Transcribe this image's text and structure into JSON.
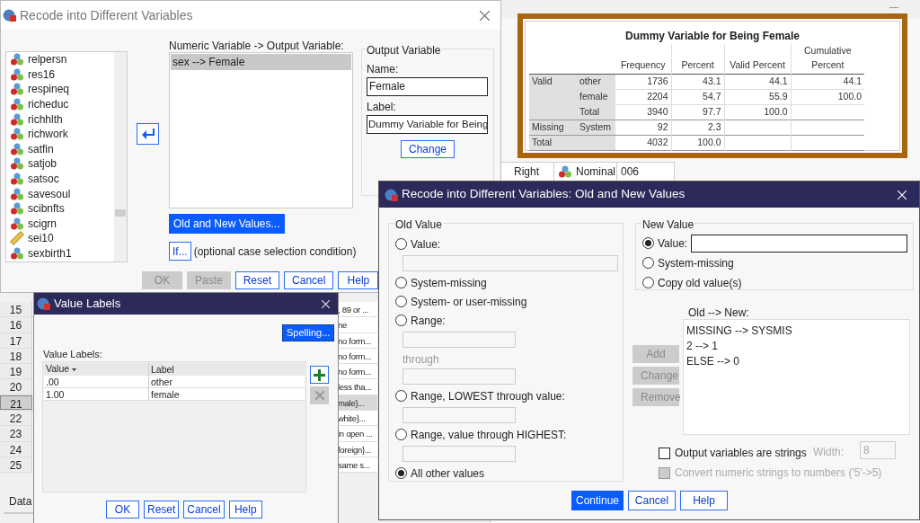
{
  "background": {
    "data_rows": [
      {
        "number": "15",
        "text": ", 89 or ...",
        "selected": false
      },
      {
        "number": "16",
        "text": "ne",
        "selected": false
      },
      {
        "number": "17",
        "text": "no form...",
        "selected": false
      },
      {
        "number": "18",
        "text": "no form...",
        "selected": false
      },
      {
        "number": "19",
        "text": "no form...",
        "selected": false
      },
      {
        "number": "20",
        "text": "less tha...",
        "selected": false
      },
      {
        "number": "21",
        "text": "male}...",
        "selected": true
      },
      {
        "number": "22",
        "text": "white}...",
        "selected": false
      },
      {
        "number": "23",
        "text": "in open ...",
        "selected": false
      },
      {
        "number": "24",
        "text": "foreign}...",
        "selected": false
      },
      {
        "number": "25",
        "text": "same s...",
        "selected": false
      }
    ],
    "tab": "Data",
    "variable_row": [
      "Right",
      "Nominal",
      "006"
    ]
  },
  "recode_dialog": {
    "title": "Recode into Different Variables",
    "variables": [
      {
        "name": "relpersn",
        "kind": "nominal"
      },
      {
        "name": "res16",
        "kind": "nominal"
      },
      {
        "name": "respineq",
        "kind": "nominal"
      },
      {
        "name": "richeduc",
        "kind": "nominal"
      },
      {
        "name": "richhlth",
        "kind": "nominal"
      },
      {
        "name": "richwork",
        "kind": "nominal"
      },
      {
        "name": "satfin",
        "kind": "nominal"
      },
      {
        "name": "satjob",
        "kind": "nominal"
      },
      {
        "name": "satsoc",
        "kind": "nominal"
      },
      {
        "name": "savesoul",
        "kind": "nominal"
      },
      {
        "name": "scibnfts",
        "kind": "nominal"
      },
      {
        "name": "scigrn",
        "kind": "nominal"
      },
      {
        "name": "sei10",
        "kind": "scale"
      },
      {
        "name": "sexbirth1",
        "kind": "nominal"
      }
    ],
    "mapping_label": "Numeric Variable -> Output Variable:",
    "mappings": [
      {
        "text": "sex --> Female",
        "selected": true
      }
    ],
    "output_group": "Output Variable",
    "name_label": "Name:",
    "name_value": "Female",
    "label_label": "Label:",
    "label_value": "Dummy Variable for Being",
    "change": "Change",
    "old_new_button": "Old and New Values...",
    "if_button": "If...",
    "if_caption": "(optional case selection condition)",
    "buttons": [
      {
        "label": "OK",
        "disabled": true
      },
      {
        "label": "Paste",
        "disabled": true
      },
      {
        "label": "Reset",
        "disabled": false
      },
      {
        "label": "Cancel",
        "disabled": false
      },
      {
        "label": "Help",
        "disabled": false
      }
    ]
  },
  "frequency_table": {
    "title": "Dummy Variable for Being Female",
    "columns": [
      "Frequency",
      "Percent",
      "Valid Percent",
      "Cumulative Percent"
    ],
    "groups": [
      {
        "name": "Valid",
        "rows": [
          {
            "label": "other",
            "values": [
              "1736",
              "43.1",
              "44.1",
              "44.1"
            ]
          },
          {
            "label": "female",
            "values": [
              "2204",
              "54.7",
              "55.9",
              "100.0"
            ]
          },
          {
            "label": "Total",
            "values": [
              "3940",
              "97.7",
              "100.0"
            ]
          }
        ]
      },
      {
        "name": "Missing",
        "rows": [
          {
            "label": "System",
            "values": [
              "92",
              "2.3"
            ]
          }
        ]
      },
      {
        "name": "Total",
        "rows": [
          {
            "values": [
              "4032",
              "100.0"
            ]
          }
        ]
      }
    ]
  },
  "value_labels_dialog": {
    "title": "Value Labels",
    "spelling": "Spelling...",
    "grid_label": "Value Labels:",
    "columns": [
      "Value",
      "Label"
    ],
    "rows": [
      {
        "value": ".00",
        "label": "other"
      },
      {
        "value": "1.00",
        "label": "female"
      }
    ],
    "buttons": [
      "OK",
      "Reset",
      "Cancel",
      "Help"
    ]
  },
  "old_new_dialog": {
    "title": "Recode into Different Variables: Old and New Values",
    "old_group": "Old Value",
    "old_items": [
      {
        "kind": "radio",
        "label": "Value:",
        "selected": false
      },
      {
        "kind": "entry"
      },
      {
        "kind": "radio",
        "label": "System-missing",
        "selected": false
      },
      {
        "kind": "radio",
        "label": "System- or user-missing",
        "selected": false
      },
      {
        "kind": "radio",
        "label": "Range:",
        "selected": false
      },
      {
        "kind": "field"
      },
      {
        "kind": "caption",
        "text": "through"
      },
      {
        "kind": "field"
      },
      {
        "kind": "radio",
        "label": "Range, LOWEST through value:",
        "selected": false
      },
      {
        "kind": "field"
      },
      {
        "kind": "radio",
        "label": "Range, value through HIGHEST:",
        "selected": false
      },
      {
        "kind": "field"
      },
      {
        "kind": "radio",
        "label": "All other values",
        "selected": true
      }
    ],
    "new_group": "New Value",
    "new_items": [
      {
        "label": "Value:",
        "selected": true,
        "field": true
      },
      {
        "label": "System-missing",
        "selected": false,
        "field": false
      },
      {
        "label": "Copy old value(s)",
        "selected": false,
        "field": false
      }
    ],
    "list_label": "Old --> New:",
    "list": [
      "MISSING --> SYSMIS",
      "2 --> 1",
      "ELSE --> 0"
    ],
    "list_buttons": [
      {
        "label": "Add",
        "disabled": true
      },
      {
        "label": "Change",
        "disabled": true
      },
      {
        "label": "Remove",
        "disabled": true
      }
    ],
    "strings_checkbox": {
      "label": "Output variables are strings",
      "checked": false,
      "disabled": false
    },
    "width_label": "Width:",
    "width_value": "8",
    "convert_checkbox": {
      "label": "Convert numeric strings to numbers ('5'->5)",
      "checked": false,
      "disabled": true
    },
    "buttons": [
      {
        "label": "Continue",
        "primary": true
      },
      {
        "label": "Cancel",
        "primary": false
      },
      {
        "label": "Help",
        "primary": false
      }
    ]
  }
}
